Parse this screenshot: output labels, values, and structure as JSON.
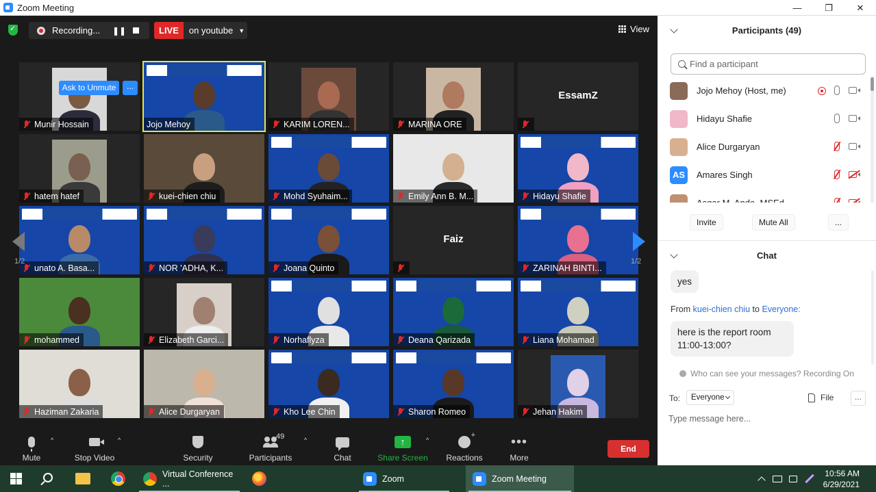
{
  "window": {
    "title": "Zoom Meeting",
    "minimize": "—",
    "maximize": "❐",
    "close": "✕"
  },
  "topbar": {
    "recording_label": "Recording...",
    "pause_glyph": "❚❚",
    "live_label": "LIVE",
    "live_destination": "on youtube",
    "live_caret": "▼",
    "view_label": "View"
  },
  "gallery": {
    "ask_unmute_label": "Ask to Unmute",
    "ask_more_label": "...",
    "page_indicator": "1/2",
    "tiles": [
      {
        "name": "Munir Hossain"
      },
      {
        "name": "Jojo Mehoy"
      },
      {
        "name": "KARIM LOREN..."
      },
      {
        "name": "MARINA ORE"
      },
      {
        "name": "",
        "big_name": "EssamZ"
      },
      {
        "name": "hatem hatef"
      },
      {
        "name": "kuei-chien chiu"
      },
      {
        "name": "Mohd Syuhaim..."
      },
      {
        "name": "Emily Ann B. M..."
      },
      {
        "name": "Hidayu Shafie"
      },
      {
        "name": "unato A. Basa..."
      },
      {
        "name": "NOR 'ADHA, K..."
      },
      {
        "name": "Joana Quinto"
      },
      {
        "name": "",
        "big_name": "Faiz"
      },
      {
        "name": "ZARINAH BINTI..."
      },
      {
        "name": "mohammed"
      },
      {
        "name": "Elizabeth Garci..."
      },
      {
        "name": "Norhaflyza"
      },
      {
        "name": "Deana Qarizada"
      },
      {
        "name": "Liana Mohamad"
      },
      {
        "name": "Haziman Zakaria"
      },
      {
        "name": "Alice Durgaryan"
      },
      {
        "name": "Kho Lee Chin"
      },
      {
        "name": "Sharon Romeo"
      },
      {
        "name": "Jehan Hakim"
      }
    ]
  },
  "toolbar": {
    "mute": "Mute",
    "stop_video": "Stop Video",
    "security": "Security",
    "participants": "Participants",
    "participants_count": "49",
    "chat": "Chat",
    "share_screen": "Share Screen",
    "share_glyph": "↑",
    "reactions": "Reactions",
    "more": "More",
    "more_glyph": "•••",
    "caret": "^",
    "end": "End"
  },
  "participants_panel": {
    "title": "Participants (49)",
    "search_placeholder": "Find a participant",
    "list": [
      {
        "name": "Jojo Mehoy (Host, me)",
        "mic": "on",
        "cam": "on",
        "recording": true
      },
      {
        "name": "Hidayu Shafie",
        "mic": "on",
        "cam": "on"
      },
      {
        "name": "Alice Durgaryan",
        "mic": "off",
        "cam": "on"
      },
      {
        "name": "Amares Singh",
        "mic": "off",
        "cam": "off",
        "initials": "AS"
      },
      {
        "name": "Asgar M. Anda, MSEd",
        "mic": "off",
        "cam": "off"
      }
    ],
    "invite": "Invite",
    "mute_all": "Mute All",
    "more": "..."
  },
  "chat_panel": {
    "title": "Chat",
    "messages": [
      {
        "text": "yes"
      },
      {
        "from_prefix": "From",
        "from": "kuei-chien chiu",
        "to_word": "to",
        "to": "Everyone:",
        "text": "here is the report room 11:00-13:00?"
      }
    ],
    "visibility_note": "Who can see your messages? Recording On",
    "to_label": "To:",
    "to_value": "Everyone",
    "file_label": "File",
    "more": "...",
    "input_placeholder": "Type message here..."
  },
  "taskbar": {
    "tasks": [
      {
        "label": "Virtual Conference ..."
      },
      {
        "label": "Zoom"
      },
      {
        "label": "Zoom Meeting"
      }
    ],
    "time": "10:56 AM",
    "date": "6/29/2021"
  },
  "colors": {
    "zoom_blue": "#2d8cff",
    "live_red": "#e02828",
    "share_green": "#23b544",
    "end_red": "#d63030",
    "active_speaker": "#e6e64c"
  }
}
